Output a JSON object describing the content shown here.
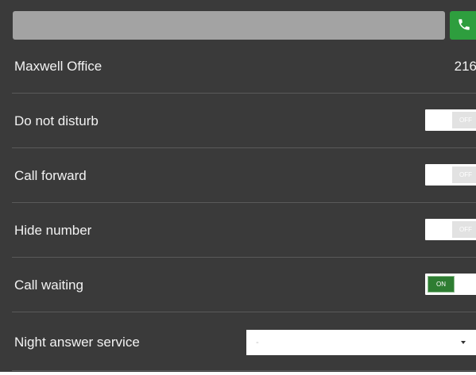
{
  "dial": {
    "value": "",
    "placeholder": ""
  },
  "call_button": {
    "icon": "phone-icon",
    "color": "#2e9e3e"
  },
  "account": {
    "name": "Maxwell Office",
    "extension": "216"
  },
  "settings": [
    {
      "label": "Do not disturb",
      "state": "OFF",
      "on": false
    },
    {
      "label": "Call forward",
      "state": "OFF",
      "on": false
    },
    {
      "label": "Hide number",
      "state": "OFF",
      "on": false
    },
    {
      "label": "Call waiting",
      "state": "ON",
      "on": true
    }
  ],
  "night_answer": {
    "label": "Night answer service",
    "selected": "-"
  },
  "colors": {
    "background": "#3a3a3a",
    "toggle_on": "#2e7d32",
    "toggle_off": "#e2e2e2"
  }
}
